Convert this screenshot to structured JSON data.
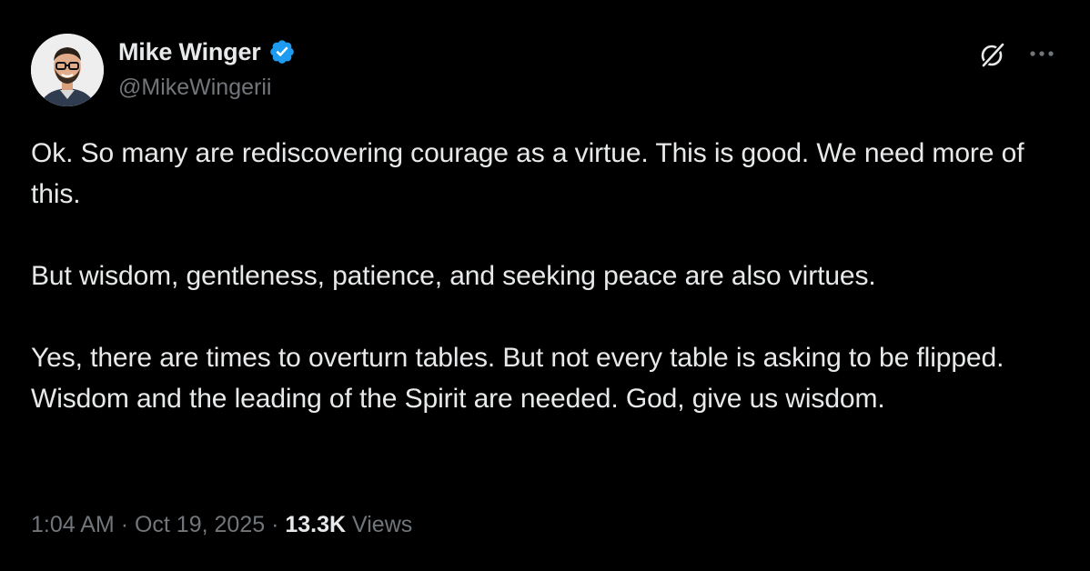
{
  "author": {
    "display_name": "Mike Winger",
    "handle": "@MikeWingerii",
    "verified": true,
    "verified_color": "#1d9bf0",
    "avatar_icon": "profile-photo"
  },
  "actions": {
    "grok_icon": "grok-icon",
    "more_icon": "more-icon"
  },
  "tweet": {
    "lines": [
      "Ok. So many are rediscovering courage as a virtue. This is good. We need more of this.",
      "But wisdom, gentleness, patience, and seeking peace are also virtues.",
      "Yes, there are times to overturn tables. But not every table is asking to be flipped. Wisdom and the leading of the Spirit are needed. God, give us wisdom."
    ]
  },
  "meta": {
    "time": "1:04 AM",
    "separator": "·",
    "date": "Oct 19, 2025",
    "views_count": "13.3K",
    "views_label": "Views"
  },
  "colors": {
    "background": "#000000",
    "primary_text": "#e7e9ea",
    "secondary_text": "#71767b"
  }
}
